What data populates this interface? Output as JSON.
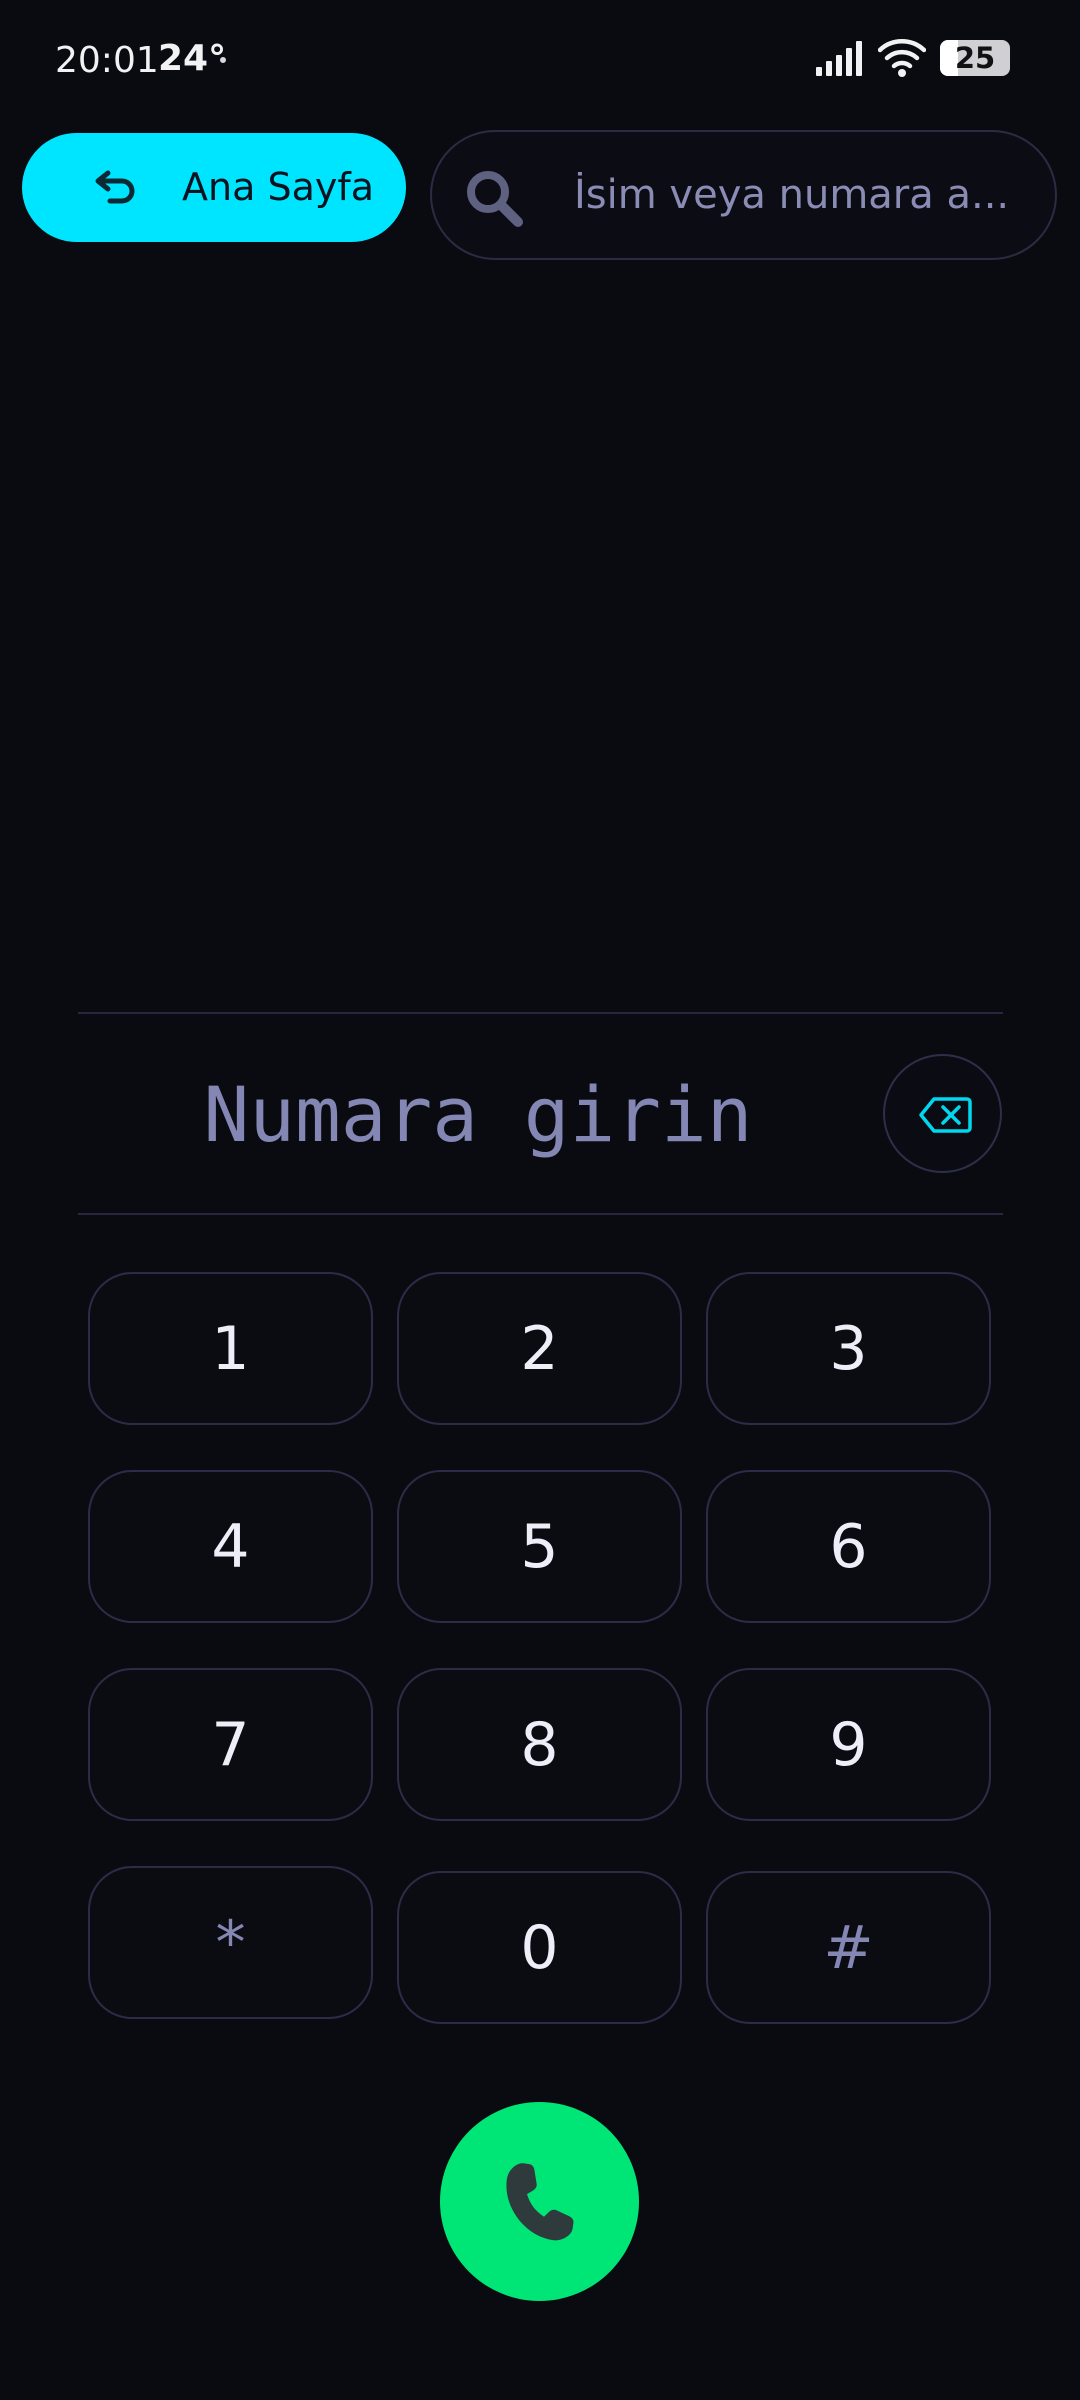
{
  "status_bar": {
    "time": "20:01",
    "temperature": "24°",
    "battery_level": "25",
    "icons": [
      "signal-icon",
      "wifi-icon",
      "battery-icon"
    ]
  },
  "header": {
    "home_button_label": "Ana Sayfa",
    "home_icon": "return-arrow-icon",
    "search_placeholder": "İsim veya numara a...",
    "search_icon": "search-icon"
  },
  "dialer": {
    "number_placeholder": "Numara girin",
    "backspace_icon": "backspace-icon",
    "keys": [
      "1",
      "2",
      "3",
      "4",
      "5",
      "6",
      "7",
      "8",
      "9",
      "*",
      "0",
      "#"
    ],
    "call_icon": "phone-icon"
  },
  "colors": {
    "background": "#0a0b10",
    "accent_cyan": "#00e5ff",
    "call_green": "#00e676",
    "muted_text": "#8486b4",
    "key_border": "#2b2d48"
  }
}
